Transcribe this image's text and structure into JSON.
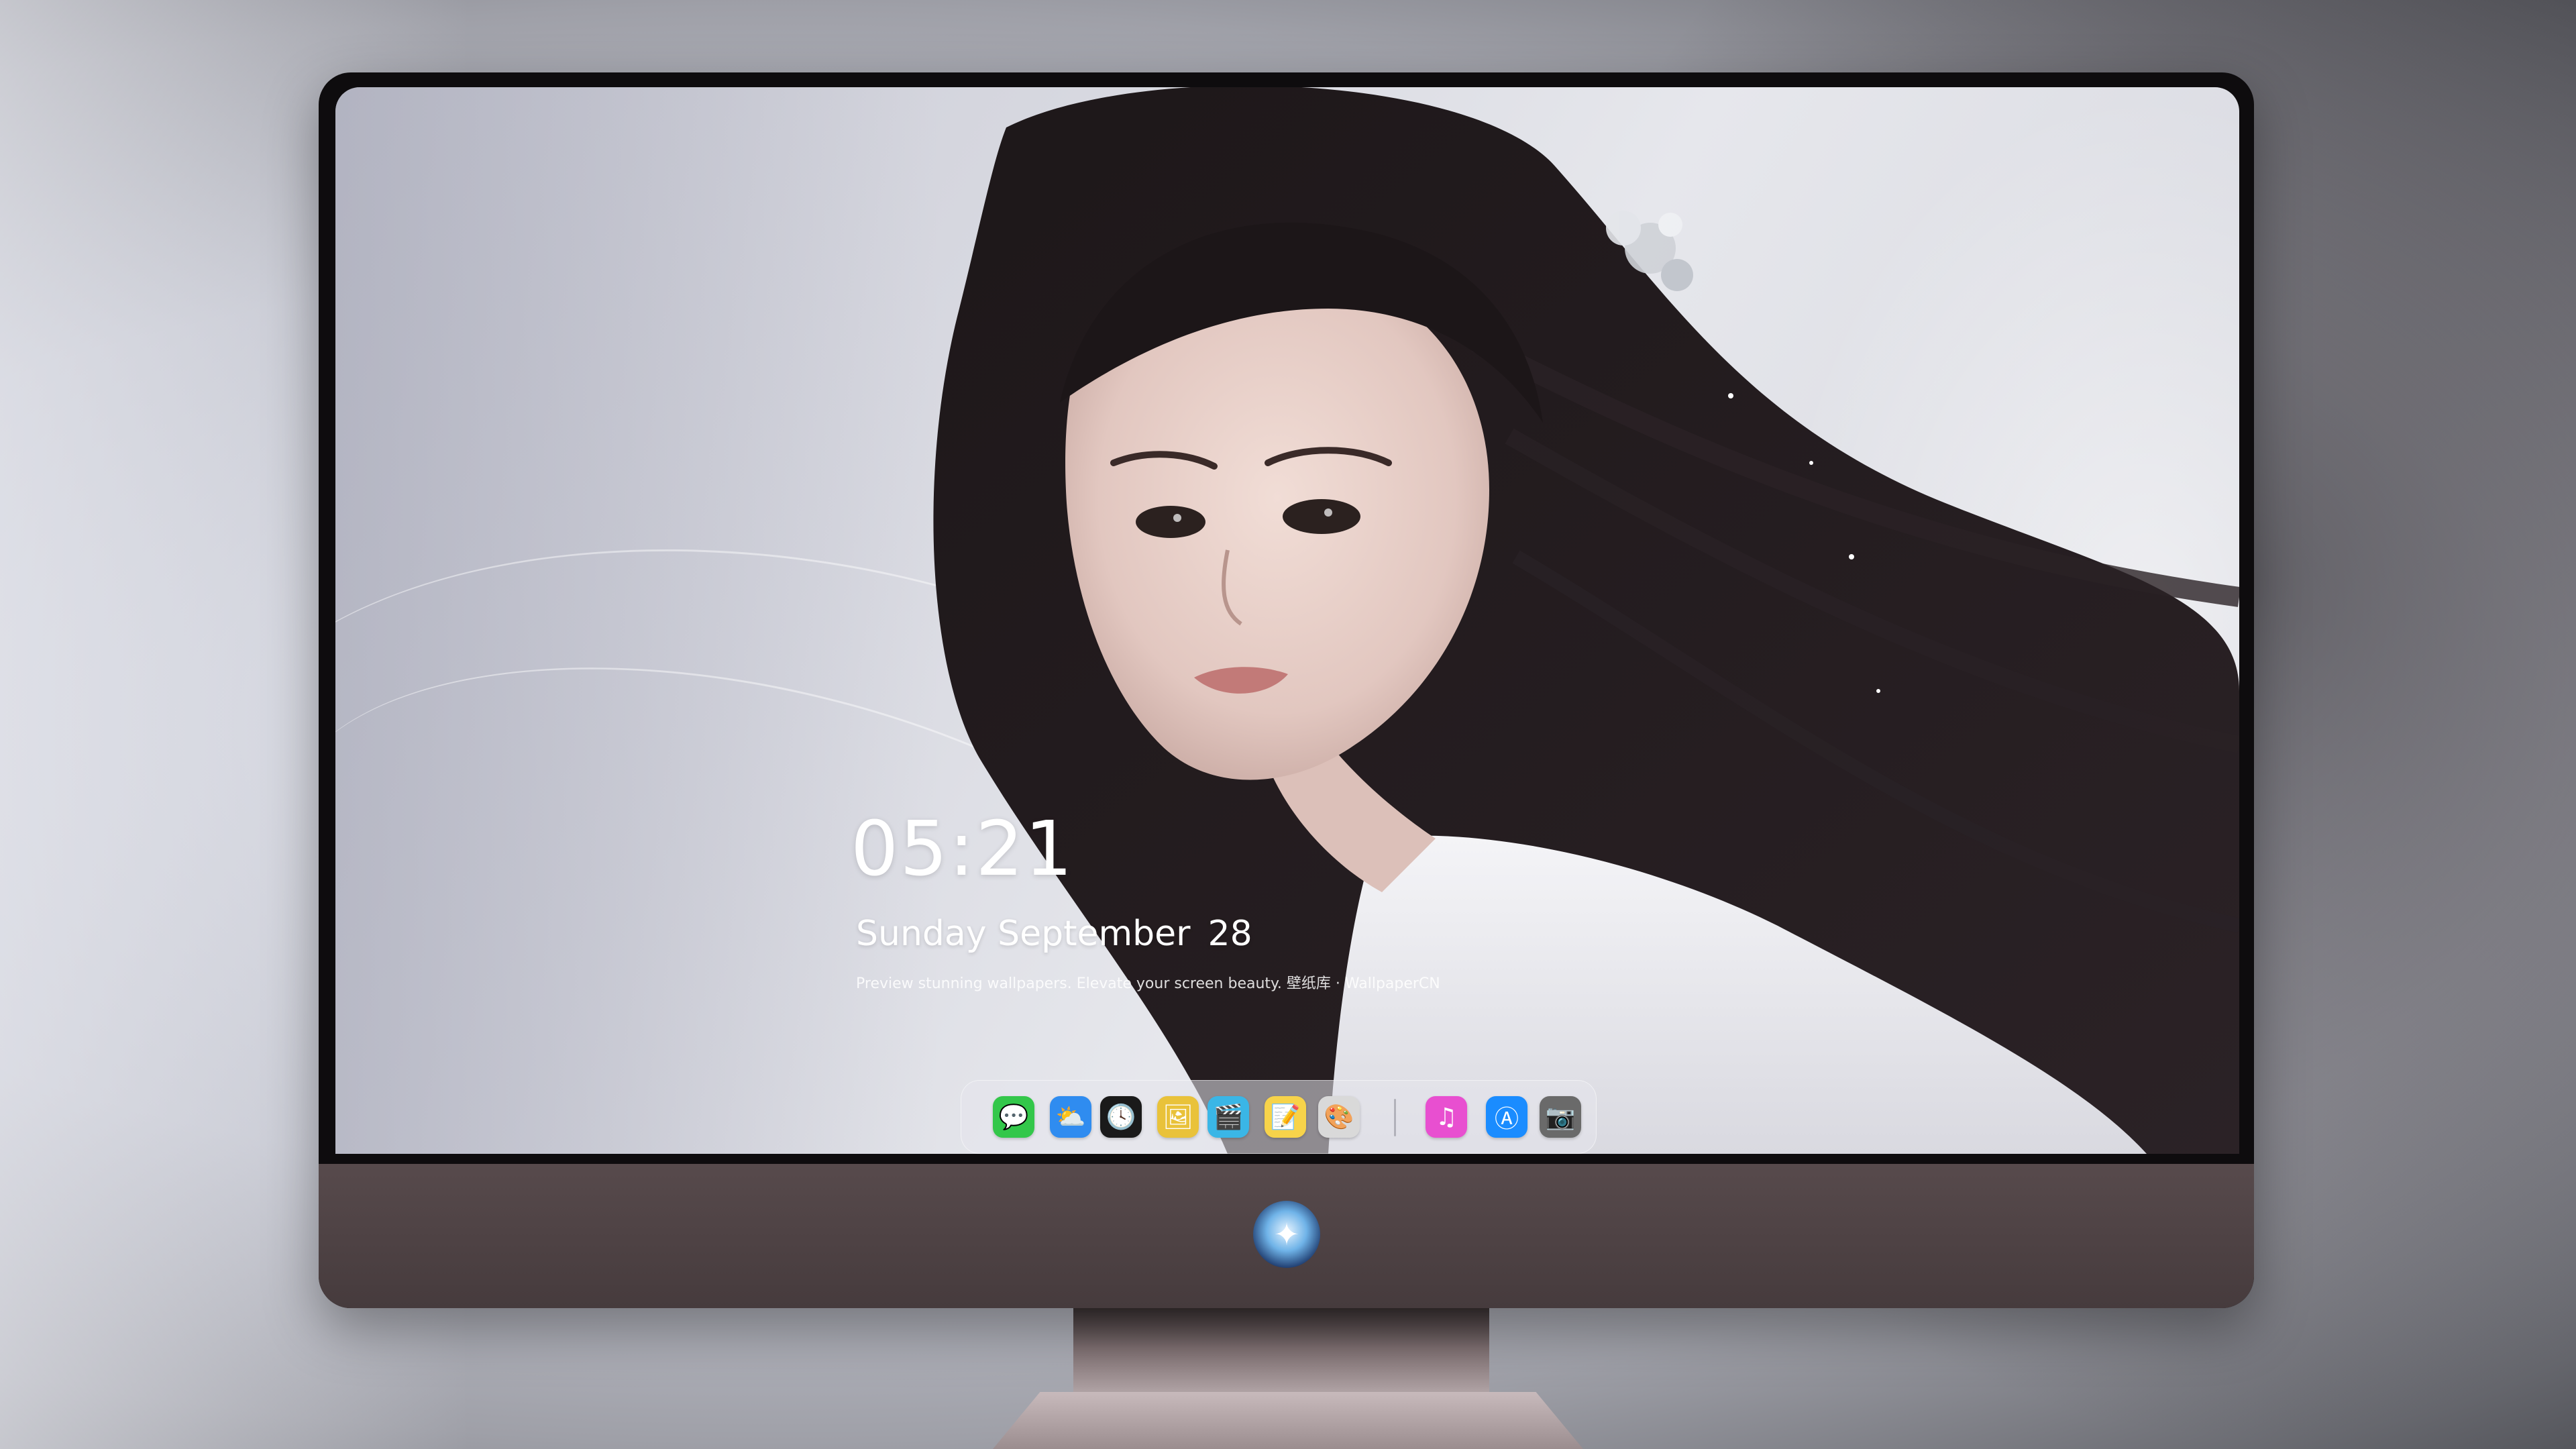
{
  "lockscreen": {
    "time": "05:21",
    "weekday": "Sunday",
    "month": "September",
    "day": "28",
    "tagline": "Preview stunning wallpapers. Elevate your screen beauty. 壁纸库 · WallpaperCN"
  },
  "dock": {
    "apps": [
      {
        "name": "messages-icon",
        "glyph": "💬",
        "color": "#33c74a"
      },
      {
        "name": "weather-icon",
        "glyph": "⛅",
        "color": "#2f8cf0"
      },
      {
        "name": "clock-icon",
        "glyph": "🕓",
        "color": "#1a1a1a"
      },
      {
        "name": "preview-icon",
        "glyph": "🖼",
        "color": "#e9c23a"
      },
      {
        "name": "clips-icon",
        "glyph": "🎬",
        "color": "#3ab6e6"
      },
      {
        "name": "notes-icon",
        "glyph": "📝",
        "color": "#f7d34a"
      },
      {
        "name": "photo-booth-icon",
        "glyph": "🎨",
        "color": "#d9d9d9"
      },
      {
        "name": "music-icon",
        "glyph": "♫",
        "color": "#e84fd0"
      },
      {
        "name": "app-store-icon",
        "glyph": "Ⓐ",
        "color": "#1a8cff"
      },
      {
        "name": "camera-icon",
        "glyph": "📷",
        "color": "#6a6a6a"
      }
    ]
  },
  "colors": {
    "monitor_bezel": "#0e0c0e",
    "monitor_chin": "#4f4345",
    "text_on_wallpaper": "#ffffff"
  }
}
